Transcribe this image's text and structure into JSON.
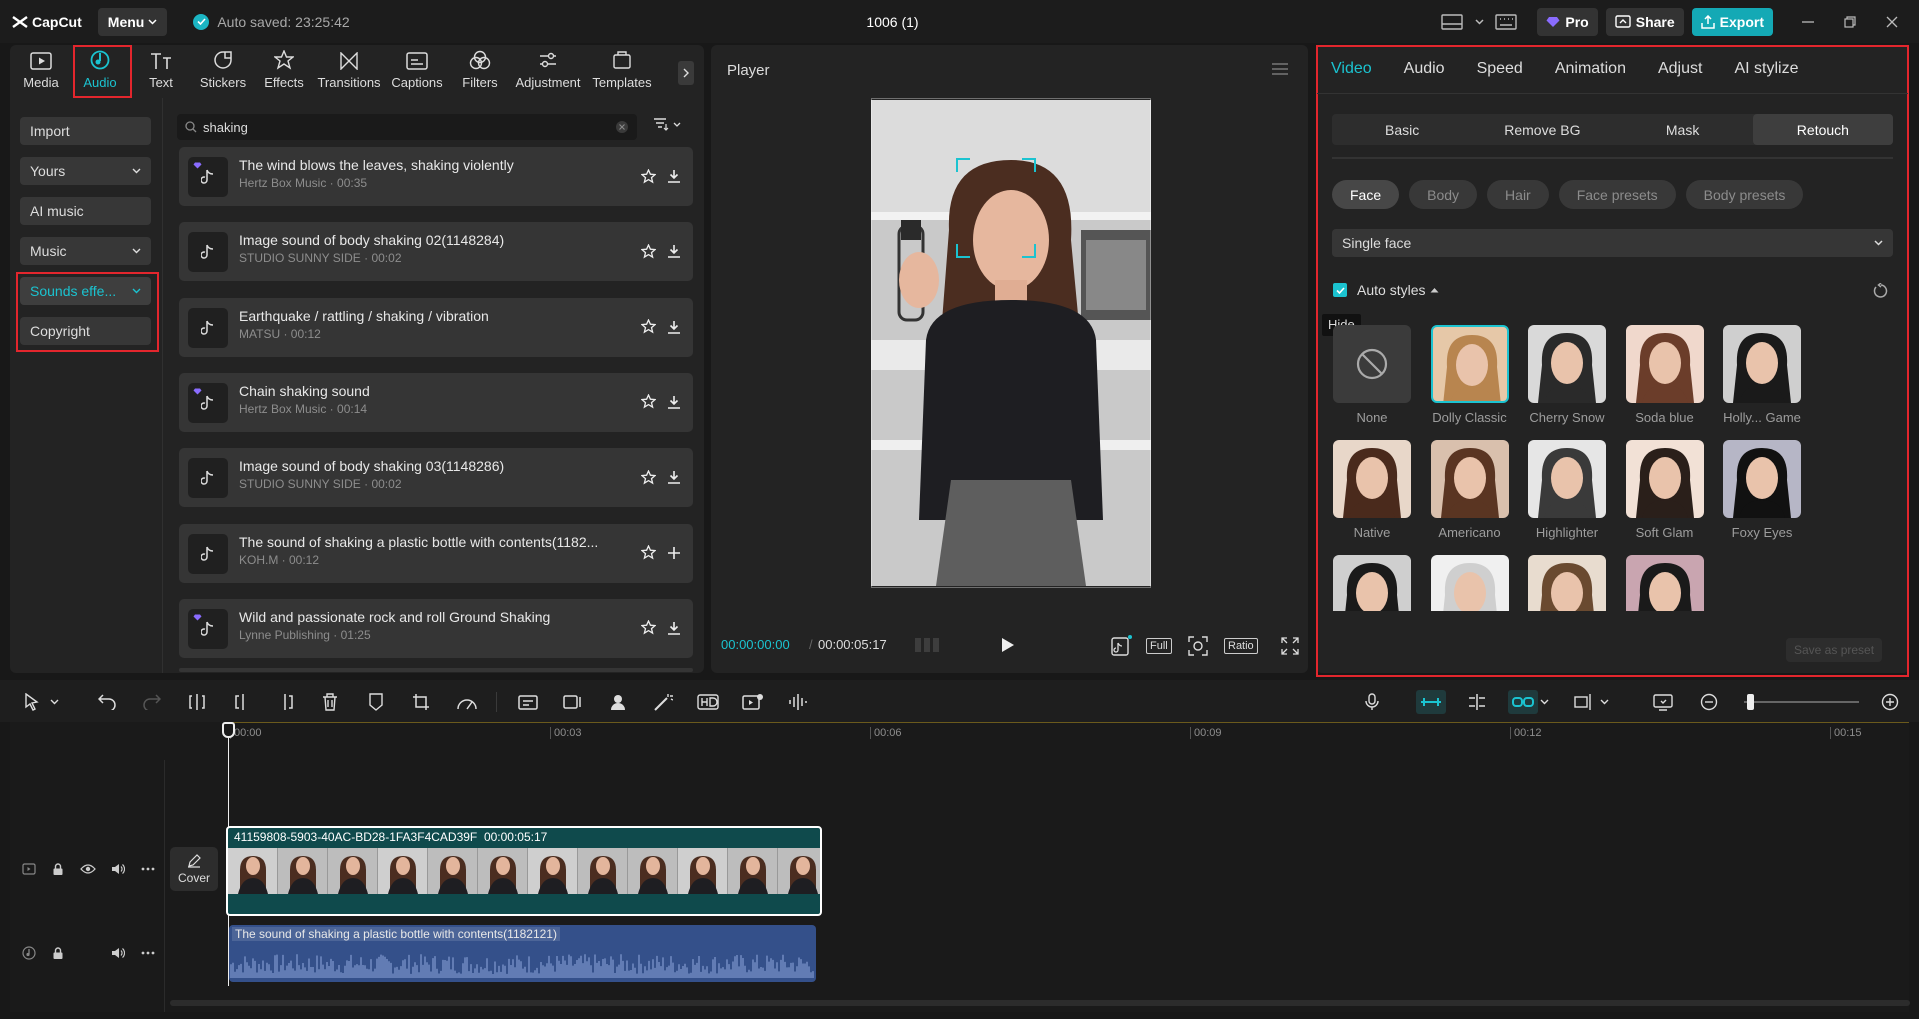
{
  "app": {
    "logo": "CapCut",
    "menu_label": "Menu",
    "autosave": "Auto saved: 23:25:42",
    "project_title": "1006 (1)",
    "pro_label": "Pro",
    "share_label": "Share",
    "export_label": "Export"
  },
  "media_tabs": [
    {
      "label": "Media",
      "icon": "media-icon"
    },
    {
      "label": "Audio",
      "icon": "audio-icon",
      "active": true
    },
    {
      "label": "Text",
      "icon": "text-icon"
    },
    {
      "label": "Stickers",
      "icon": "sticker-icon"
    },
    {
      "label": "Effects",
      "icon": "effects-icon"
    },
    {
      "label": "Transitions",
      "icon": "transitions-icon"
    },
    {
      "label": "Captions",
      "icon": "captions-icon"
    },
    {
      "label": "Filters",
      "icon": "filters-icon"
    },
    {
      "label": "Adjustment",
      "icon": "adjustment-icon"
    },
    {
      "label": "Templates",
      "icon": "templates-icon"
    }
  ],
  "audio_sidebar": [
    {
      "label": "Import",
      "chevron": false
    },
    {
      "label": "Yours",
      "chevron": true
    },
    {
      "label": "AI music",
      "chevron": false
    },
    {
      "label": "Music",
      "chevron": true
    },
    {
      "label": "Sounds effe...",
      "chevron": true,
      "active": true
    },
    {
      "label": "Copyright",
      "chevron": false
    }
  ],
  "search": {
    "value": "shaking"
  },
  "sounds": [
    {
      "title": "The wind blows the leaves, shaking violently",
      "meta": "Hertz Box Music · 00:35",
      "pro": true,
      "action": "download"
    },
    {
      "title": "Image sound of body shaking 02(1148284)",
      "meta": "STUDIO SUNNY SIDE · 00:02",
      "pro": false,
      "action": "download"
    },
    {
      "title": "Earthquake / rattling / shaking / vibration",
      "meta": "MATSU · 00:12",
      "pro": false,
      "action": "download"
    },
    {
      "title": "Chain shaking sound",
      "meta": "Hertz Box Music · 00:14",
      "pro": true,
      "action": "download"
    },
    {
      "title": "Image sound of body shaking 03(1148286)",
      "meta": "STUDIO SUNNY SIDE · 00:02",
      "pro": false,
      "action": "download"
    },
    {
      "title": "The sound of shaking a plastic bottle with contents(1182...",
      "meta": "KOH.M · 00:12",
      "pro": false,
      "action": "add"
    },
    {
      "title": "Wild and passionate rock and roll Ground Shaking",
      "meta": "Lynne Publishing · 01:25",
      "pro": true,
      "action": "download"
    }
  ],
  "player": {
    "title": "Player",
    "current_time": "00:00:00:00",
    "total_time": "00:00:05:17",
    "full_label": "Full",
    "ratio_label": "Ratio"
  },
  "properties": {
    "tabs": [
      "Video",
      "Audio",
      "Speed",
      "Animation",
      "Adjust",
      "AI stylize"
    ],
    "subtabs": [
      "Basic",
      "Remove BG",
      "Mask",
      "Retouch"
    ],
    "pills": [
      "Face",
      "Body",
      "Hair",
      "Face presets",
      "Body presets"
    ],
    "face_select": "Single face",
    "auto_styles_label": "Auto styles",
    "tooltip": "Hide",
    "styles": [
      "None",
      "Dolly Classic",
      "Cherry Snow",
      "Soda blue",
      "Holly... Game",
      "Native",
      "Americano",
      "Highlighter",
      "Soft Glam",
      "Foxy Eyes",
      "",
      "",
      "",
      ""
    ],
    "save_preset": "Save as preset"
  },
  "timeline": {
    "ruler": [
      "00:00",
      "00:03",
      "00:06",
      "00:09",
      "00:12",
      "00:15"
    ],
    "video_clip_label": "41159808-5903-40AC-BD28-1FA3F4CAD39F",
    "video_clip_duration": "00:00:05:17",
    "cover_label": "Cover",
    "audio_clip_label": "The sound of shaking a plastic bottle with contents(1182121)"
  },
  "colors": {
    "accent": "#1bc3d0",
    "highlight": "#e3262d",
    "export": "#14a9b5"
  }
}
